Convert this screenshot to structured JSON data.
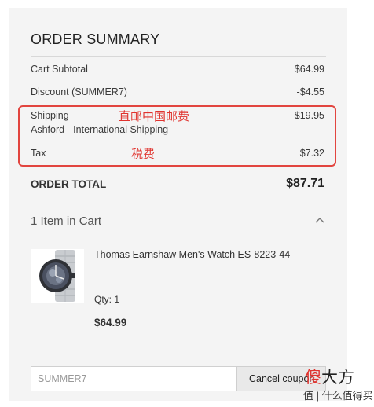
{
  "summary": {
    "title": "ORDER SUMMARY",
    "rows": {
      "subtotal": {
        "label": "Cart Subtotal",
        "value": "$64.99"
      },
      "discount": {
        "label": "Discount (SUMMER7)",
        "value": "-$4.55"
      },
      "shipping": {
        "label": "Shipping",
        "sublabel": "Ashford - International Shipping",
        "value": "$19.95"
      },
      "tax": {
        "label": "Tax",
        "value": "$7.32"
      }
    },
    "total": {
      "label": "ORDER TOTAL",
      "value": "$87.71"
    }
  },
  "annotations": {
    "shipping_note": "直邮中国邮费",
    "tax_note": "税费",
    "box_color": "#e2453f"
  },
  "cart": {
    "header": "1 Item in Cart",
    "toggle_icon": "chevron-up-icon",
    "item": {
      "name": "Thomas Earnshaw Men's Watch ES-8223-44",
      "qty": "Qty: 1",
      "price": "$64.99",
      "image": "watch-product-image"
    }
  },
  "coupon": {
    "input_value": "SUMMER7",
    "button_label": "Cancel coupon"
  },
  "watermark": {
    "big_prefix": "傻",
    "big_rest": "大方",
    "small": "值 | 什么值得买"
  }
}
